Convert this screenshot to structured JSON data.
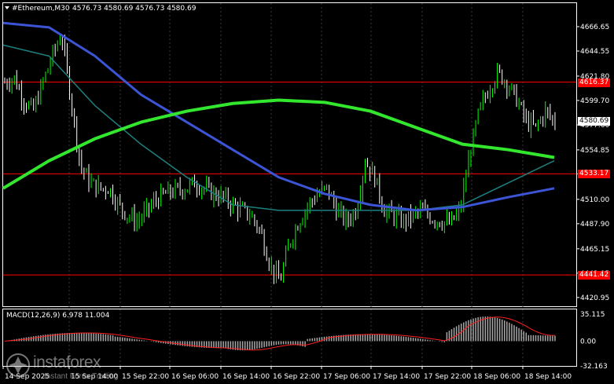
{
  "header": {
    "symbol": "#Ethereum,M30",
    "ohlc": "4576.73 4580.69 4576.73 4580.69"
  },
  "colors": {
    "background": "#000000",
    "grid": "#3a3a3a",
    "bull": "#00ff00",
    "bear": "#ffffff",
    "ma_slow": "#33e62e",
    "ma_mid": "#3b55d6",
    "ma_fast": "#1f7f7f",
    "level": "#ff0000",
    "macd_hist": "#a8a8a8",
    "macd_signal": "#ff2020"
  },
  "price_axis": {
    "ticks": [
      "4666.65",
      "4644.55",
      "4621.80",
      "4599.70",
      "4577.60",
      "4554.85",
      "4533.17",
      "4510.00",
      "4487.90",
      "4465.15",
      "4443.05",
      "4420.95"
    ]
  },
  "levels": [
    {
      "price": 4616.37,
      "label": "4616.37"
    },
    {
      "price": 4533.17,
      "label": "4533.17"
    },
    {
      "price": 4441.42,
      "label": "4441.42"
    }
  ],
  "current_price": {
    "value": 4580.69,
    "label": "4580.69"
  },
  "macd": {
    "title": "MACD(12,26,9) 6.978 11.004",
    "ticks": [
      "35.115",
      "0.00",
      "-32.163"
    ]
  },
  "time_axis": {
    "labels": [
      "14 Sep 2025",
      "15 Sep 14:00",
      "15 Sep 22:00",
      "16 Sep 06:00",
      "16 Sep 14:00",
      "16 Sep 22:00",
      "17 Sep 06:00",
      "17 Sep 14:00",
      "17 Sep 22:00",
      "18 Sep 06:00",
      "18 Sep 14:00"
    ]
  },
  "watermark": {
    "brand": "instaforex",
    "sub": "Instant Forex Trading"
  },
  "chart_data": {
    "type": "candlestick",
    "title": "#Ethereum,M30",
    "ylim": [
      4413,
      4688
    ],
    "series": [
      {
        "name": "price",
        "values_close_approx": [
          4616,
          4620,
          4600,
          4590,
          4615,
          4640,
          4660,
          4600,
          4540,
          4525,
          4520,
          4520,
          4505,
          4495,
          4490,
          4500,
          4510,
          4515,
          4518,
          4520,
          4525,
          4520,
          4515,
          4512,
          4505,
          4500,
          4495,
          4480,
          4450,
          4435,
          4470,
          4490,
          4505,
          4515,
          4520,
          4500,
          4490,
          4500,
          4545,
          4530,
          4500,
          4495,
          4490,
          4495,
          4500,
          4493,
          4490,
          4488,
          4500,
          4550,
          4590,
          4610,
          4625,
          4615,
          4600,
          4580,
          4575,
          4590,
          4580
        ]
      },
      {
        "name": "ma_slow",
        "values_approx": [
          4520,
          4545,
          4565,
          4580,
          4590,
          4597,
          4600,
          4598,
          4590,
          4575,
          4560,
          4555,
          4548
        ]
      },
      {
        "name": "ma_mid",
        "values_approx": [
          4670,
          4666,
          4640,
          4605,
          4580,
          4555,
          4530,
          4515,
          4505,
          4500,
          4503,
          4512,
          4520
        ]
      },
      {
        "name": "ma_fast",
        "values_approx": [
          4650,
          4640,
          4595,
          4560,
          4530,
          4505,
          4500,
          4500,
          4500,
          4500,
          4505,
          4525,
          4545
        ]
      }
    ],
    "levels": [
      4616.37,
      4533.17,
      4441.42
    ],
    "macd": {
      "name": "MACD(12,26,9)",
      "macd": 6.978,
      "signal": 11.004,
      "ylim": [
        -32.163,
        35.115
      ]
    }
  }
}
